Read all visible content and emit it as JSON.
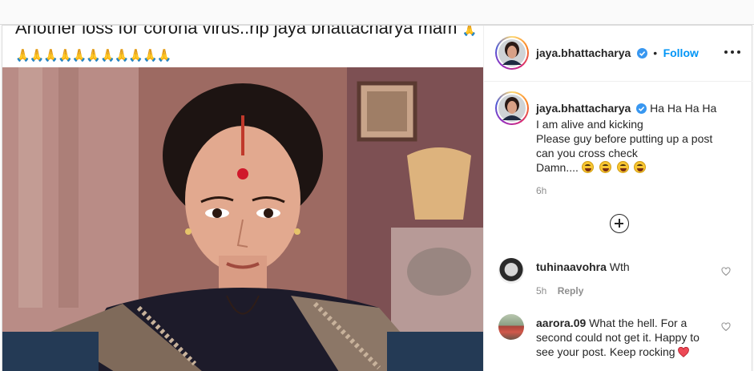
{
  "post": {
    "image_caption_text": "Another loss for corona virus..rip jaya bhattacharya mam",
    "image_caption_emojis": "🙏🙏🙏🙏🙏🙏🙏🙏🙏🙏🙏🙏",
    "image_description": "Photo of a woman with a red bindi wearing a black saree with patterned border"
  },
  "header": {
    "username": "jaya.bhattacharya",
    "separator": "•",
    "follow_label": "Follow"
  },
  "caption": {
    "username": "jaya.bhattacharya",
    "lines": [
      "Ha Ha Ha Ha",
      "I am alive and kicking",
      "Please guy before putting up a post",
      "can you cross check",
      "Damn...."
    ],
    "emoji_count": 4,
    "time": "6h"
  },
  "comments": [
    {
      "username": "tuhinaavohra",
      "text": "Wth",
      "time": "5h",
      "reply_label": "Reply"
    },
    {
      "username": "aarora.09",
      "text": "What the hell. For a second could not get it. Happy to see your post. Keep rocking"
    }
  ],
  "colors": {
    "follow": "#0095f6",
    "verified": "#3897f0",
    "heart": "#ed4956",
    "muted_text": "#8e8e8e"
  },
  "icons": [
    "verified-badge-icon",
    "more-options-icon",
    "load-more-comments-icon",
    "like-heart-icon",
    "red-heart-emoji-icon",
    "grinning-tears-emoji-icon",
    "folded-hands-emoji-icon"
  ]
}
